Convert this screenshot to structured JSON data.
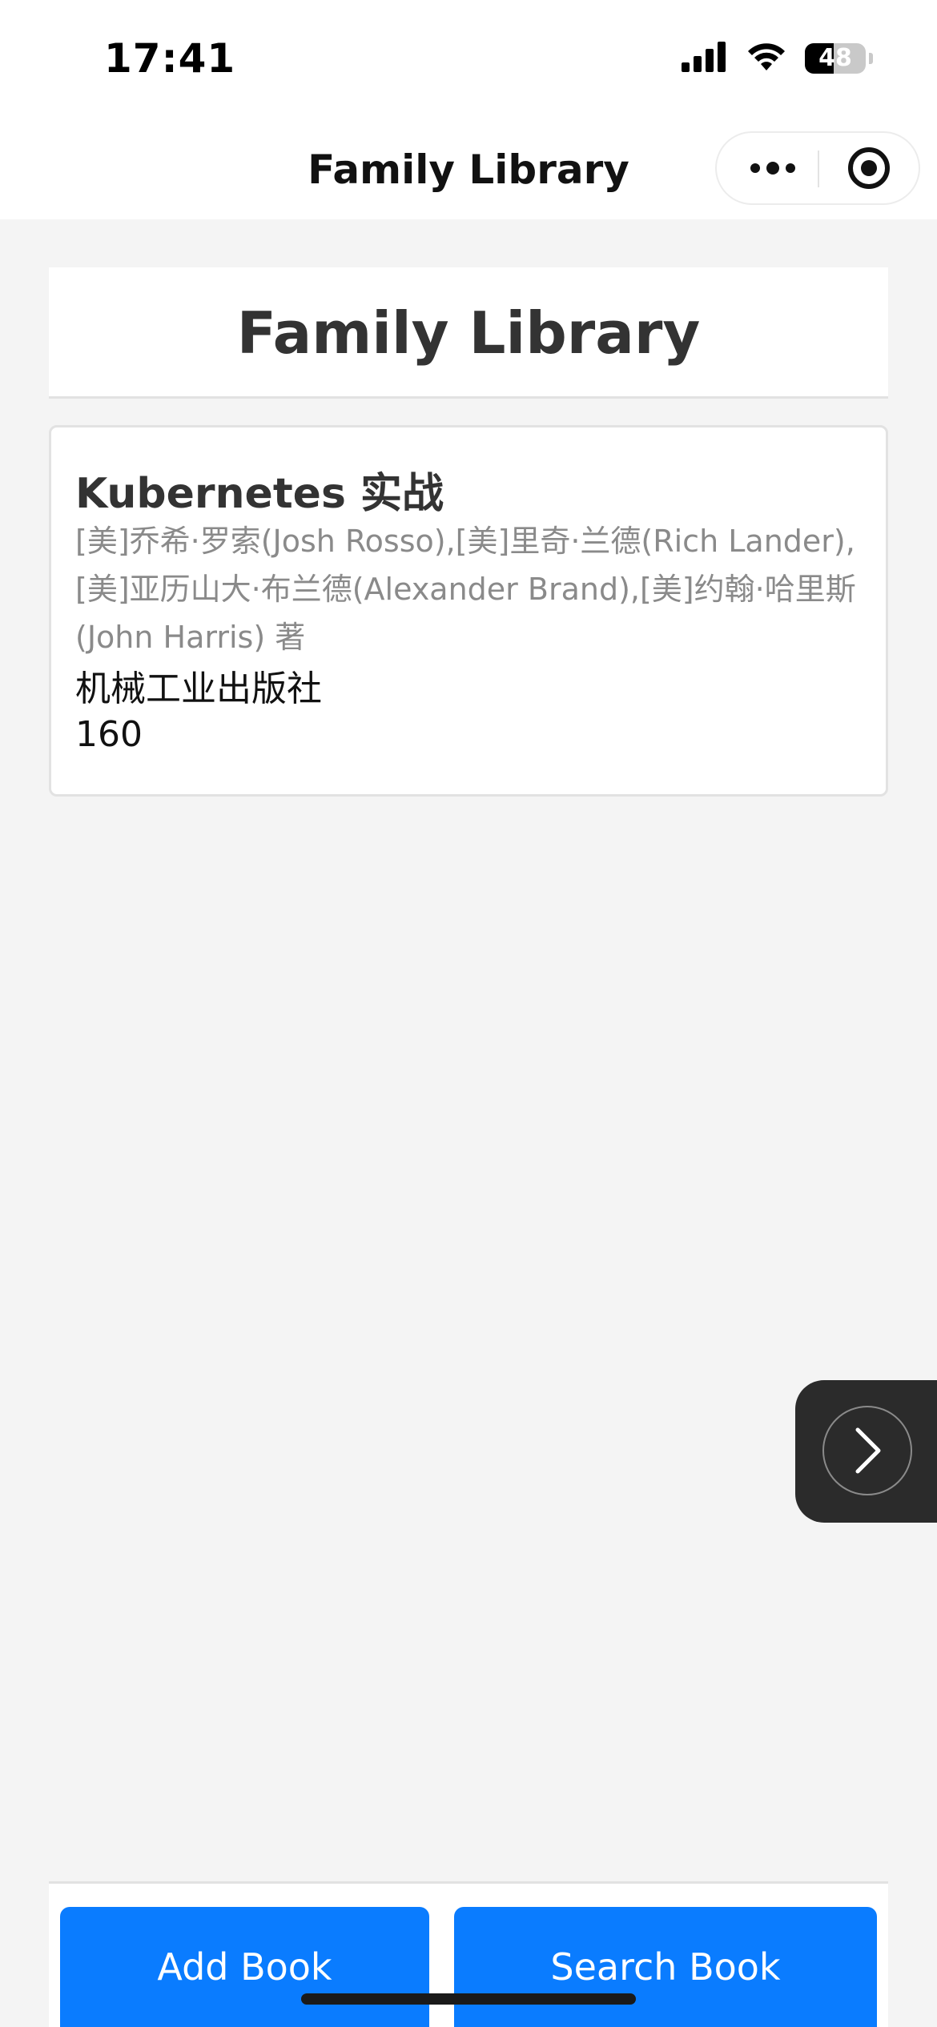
{
  "status_bar": {
    "time": "17:41",
    "battery_level": "48",
    "battery_fraction": 0.48,
    "signal_icon": "cellular-signal-icon",
    "wifi_icon": "wifi-icon"
  },
  "nav": {
    "title": "Family Library",
    "more_icon": "more-dots-icon",
    "close_icon": "target-close-icon"
  },
  "header": {
    "title": "Family Library"
  },
  "books": [
    {
      "title": "Kubernetes 实战",
      "authors": "[美]乔希·罗索(Josh Rosso),[美]里奇·兰德(Rich Lander),[美]亚历山大·布兰德(Alexander Brand),[美]约翰·哈里斯(John Harris) 著",
      "publisher": "机械工业出版社",
      "pages": "160"
    }
  ],
  "floating_button": {
    "icon": "chevron-right-icon"
  },
  "actions": {
    "add_label": "Add Book",
    "search_label": "Search Book"
  },
  "colors": {
    "primary_button": "#0a7cff",
    "background": "#f4f4f4",
    "card": "#ffffff",
    "author_text": "#8a8a8a"
  }
}
